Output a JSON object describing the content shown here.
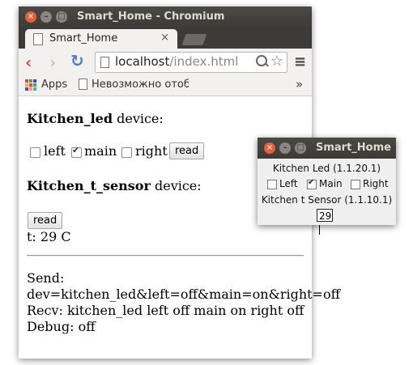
{
  "window": {
    "title": "Smart_Home - Chromium"
  },
  "tab": {
    "label": "Smart_Home",
    "close": "×"
  },
  "toolbar": {
    "url_host": "localhost",
    "url_path": "/index.html",
    "back": "‹",
    "forward": "›",
    "reload": "↻",
    "star": "☆",
    "menu": "≡"
  },
  "bookmarks": {
    "apps": "Apps",
    "item": "Невозможно отоб",
    "more": "»"
  },
  "page": {
    "led_device_name": "Kitchen_led",
    "device_suffix": " device:",
    "left_label": "left",
    "main_label": "main",
    "right_label": "right",
    "left_checked": false,
    "main_checked": true,
    "right_checked": false,
    "read_label": "read",
    "sensor_device_name": "Kitchen_t_sensor",
    "sensor_read_label": "read",
    "temperature_text": "t: 29 C",
    "send_label": "Send:",
    "send_value": "dev=kitchen_led&left=off&main=on&right=off",
    "recv_text": "Recv: kitchen_led left off main on right off",
    "debug_text": "Debug: off"
  },
  "gtk": {
    "title": "Smart_Home",
    "led_label": "Kitchen Led (1.1.20.1)",
    "left_label": "Left",
    "main_label": "Main",
    "right_label": "Right",
    "sensor_label": "Kitchen t Sensor (1.1.10.1)",
    "temp_value": "29"
  },
  "colors": {
    "titlebar": "#3c3b37",
    "close_button": "#e2603b",
    "back_arrow": "#d5562e",
    "reload": "#4a7fd0"
  }
}
